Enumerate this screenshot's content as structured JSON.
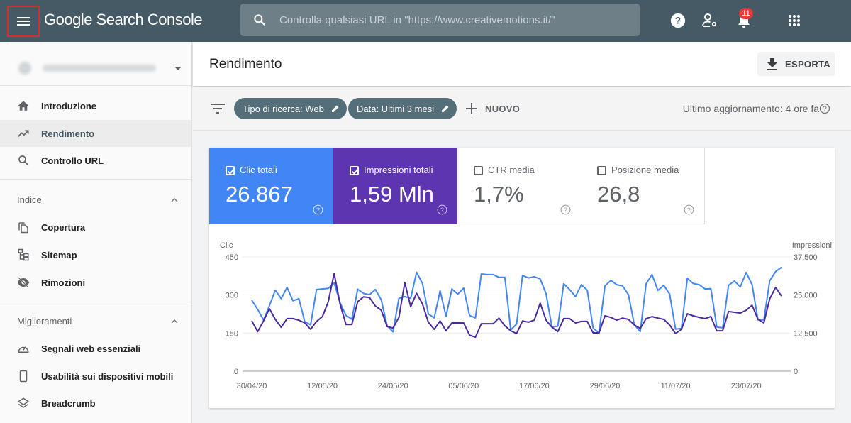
{
  "app": {
    "title_google": "Google",
    "title_rest": " Search Console",
    "search_placeholder": "Controlla qualsiasi URL in \"https://www.creativemotions.it/\"",
    "notifications_count": "11",
    "topbar_icons": [
      "menu-icon",
      "help-icon",
      "user-settings-icon",
      "bell-icon",
      "apps-grid-icon"
    ]
  },
  "sidebar": {
    "property": "https://www.creativemotions.it/",
    "items_top": [
      {
        "label": "Introduzione",
        "icon": "home-icon"
      },
      {
        "label": "Rendimento",
        "icon": "trending-up-icon",
        "active": true
      },
      {
        "label": "Controllo URL",
        "icon": "search-icon"
      }
    ],
    "sections": [
      {
        "title": "Indice",
        "items": [
          {
            "label": "Copertura",
            "icon": "copy-icon"
          },
          {
            "label": "Sitemap",
            "icon": "sitemap-icon"
          },
          {
            "label": "Rimozioni",
            "icon": "eye-off-icon"
          }
        ]
      },
      {
        "title": "Miglioramenti",
        "items": [
          {
            "label": "Segnali web essenziali",
            "icon": "speedometer-icon"
          },
          {
            "label": "Usabilità sui dispositivi mobili",
            "icon": "smartphone-icon"
          },
          {
            "label": "Breadcrumb",
            "icon": "layers-icon"
          }
        ]
      }
    ]
  },
  "header": {
    "title": "Rendimento",
    "export_label": "ESPORTA"
  },
  "filters": {
    "chips": [
      "Tipo di ricerca: Web",
      "Data: Ultimi 3 mesi"
    ],
    "new_label": "NUOVO",
    "last_update": "Ultimo aggiornamento: 4 ore fa"
  },
  "metrics": [
    {
      "label": "Clic totali",
      "value": "26.867",
      "checked": true,
      "color": "#4285f4"
    },
    {
      "label": "Impressioni totali",
      "value": "1,59 Mln",
      "checked": true,
      "color": "#5e35b1"
    },
    {
      "label": "CTR media",
      "value": "1,7%",
      "checked": false
    },
    {
      "label": "Posizione media",
      "value": "26,8",
      "checked": false
    }
  ],
  "chart_data": {
    "type": "line",
    "title": "",
    "ylabel_left": "Clic",
    "ylabel_right": "Impressioni",
    "ylim_left": [
      0,
      450
    ],
    "ylim_right": [
      0,
      37500
    ],
    "yticks_left": [
      "0",
      "150",
      "300",
      "450"
    ],
    "yticks_right": [
      "0",
      "12.500",
      "25.000",
      "37.500"
    ],
    "xtick_labels": [
      "30/04/20",
      "12/05/20",
      "24/05/20",
      "05/06/20",
      "17/06/20",
      "29/06/20",
      "11/07/20",
      "23/07/20"
    ],
    "xtick_day_index": [
      0,
      12,
      24,
      36,
      48,
      60,
      72,
      84
    ],
    "grid": true,
    "start_date": "30/04/20",
    "num_days": 91,
    "series": [
      {
        "name": "Clic",
        "axis": "left",
        "color": "#4b2a9e",
        "values": [
          198,
          156,
          198,
          246,
          204,
          173,
          207,
          207,
          201,
          190,
          165,
          196,
          215,
          274,
          385,
          265,
          184,
          184,
          274,
          293,
          290,
          257,
          240,
          176,
          170,
          212,
          349,
          254,
          307,
          265,
          193,
          165,
          198,
          159,
          190,
          190,
          190,
          142,
          134,
          187,
          187,
          187,
          209,
          179,
          159,
          148,
          198,
          193,
          201,
          268,
          201,
          173,
          156,
          207,
          207,
          190,
          196,
          196,
          151,
          151,
          218,
          212,
          201,
          209,
          204,
          182,
          168,
          207,
          215,
          209,
          204,
          182,
          148,
          165,
          226,
          218,
          212,
          207,
          215,
          159,
          159,
          235,
          232,
          229,
          240,
          260,
          204,
          190,
          285,
          330,
          296
        ]
      },
      {
        "name": "Impressioni",
        "axis": "right",
        "color": "#4285f4",
        "values": [
          23300,
          20300,
          16800,
          21500,
          26600,
          23800,
          27500,
          23100,
          23800,
          16300,
          15200,
          26800,
          27000,
          27200,
          29000,
          22500,
          18300,
          17100,
          26900,
          25500,
          25100,
          26800,
          23400,
          14900,
          12900,
          23900,
          24500,
          23900,
          32500,
          28800,
          18800,
          17500,
          26400,
          18000,
          27000,
          25300,
          27300,
          18300,
          17500,
          31900,
          31700,
          31700,
          30800,
          30800,
          13500,
          15500,
          31400,
          30600,
          31000,
          30300,
          25400,
          14500,
          14800,
          28700,
          26800,
          24500,
          28400,
          26600,
          14100,
          12600,
          28000,
          29800,
          28400,
          28000,
          25100,
          15200,
          13000,
          28700,
          31700,
          26500,
          28200,
          25300,
          13800,
          14000,
          30500,
          28800,
          28400,
          27000,
          27100,
          14500,
          14200,
          28200,
          29600,
          27700,
          32400,
          28400,
          16900,
          16800,
          29700,
          32700,
          34100
        ]
      }
    ]
  }
}
